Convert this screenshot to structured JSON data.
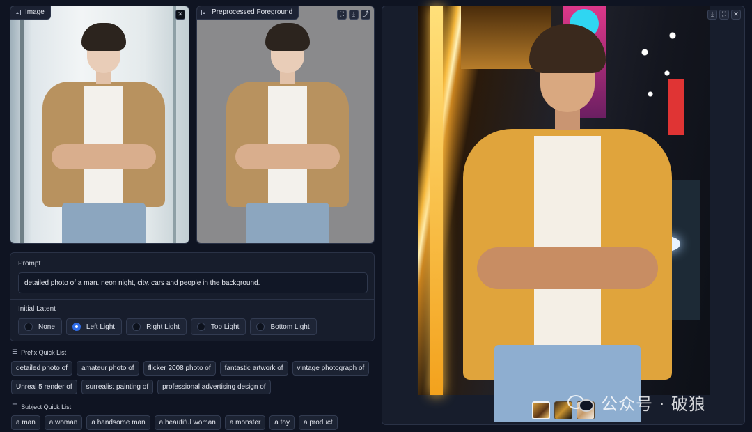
{
  "input_image": {
    "label": "Image",
    "close_glyph": "✕"
  },
  "foreground": {
    "label": "Preprocessed Foreground",
    "buttons": [
      "⛶",
      "⤓",
      "⤴"
    ]
  },
  "output": {
    "buttons": [
      "⤓",
      "⛶",
      "✕"
    ]
  },
  "prompt": {
    "label": "Prompt",
    "value": "detailed photo of a man. neon night, city. cars and people in the background."
  },
  "initial_latent": {
    "label": "Initial Latent",
    "options": [
      "None",
      "Left Light",
      "Right Light",
      "Top Light",
      "Bottom Light"
    ],
    "selected": "Left Light"
  },
  "prefix_list": {
    "title": "Prefix Quick List",
    "row1": [
      "detailed photo of",
      "amateur photo of",
      "flicker 2008 photo of",
      "fantastic artwork of",
      "vintage photograph of"
    ],
    "row2": [
      "Unreal 5 render of",
      "surrealist painting of",
      "professional advertising design of"
    ]
  },
  "subject_list": {
    "title": "Subject Quick List",
    "items": [
      "a man",
      "a woman",
      "a handsome man",
      "a beautiful woman",
      "a monster",
      "a toy",
      "a product"
    ]
  },
  "watermark": {
    "text": "公众号 · 破狼"
  }
}
